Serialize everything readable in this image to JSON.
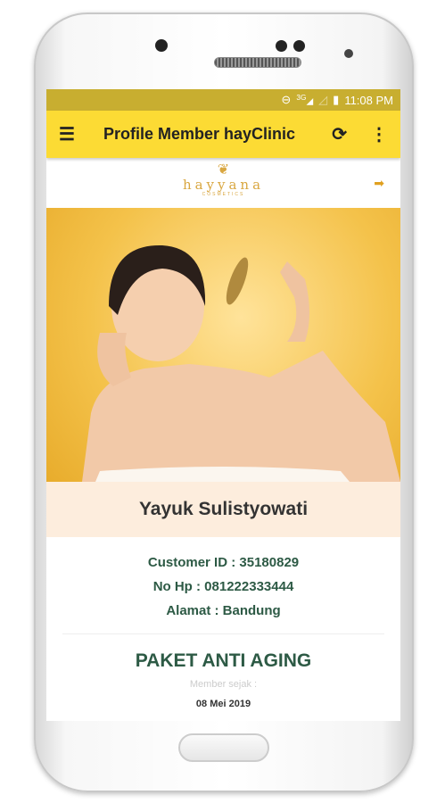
{
  "status_bar": {
    "time": "11:08 PM",
    "network": "3G"
  },
  "toolbar": {
    "title": "Profile Member hayClinic",
    "menu_icon": "hamburger-icon",
    "refresh_icon": "refresh-icon",
    "more_icon": "more-vert-icon"
  },
  "brand": {
    "name": "hayyana",
    "sub": "COSMETICS"
  },
  "profile": {
    "name": "Yayuk Sulistyowati",
    "customer_id": "Customer ID : 35180829",
    "phone": "No Hp : 081222333444",
    "address": "Alamat : Bandung"
  },
  "package": {
    "title": "PAKET ANTI AGING",
    "member_since_label": "Member sejak :",
    "member_since_date": "08 Mei 2019"
  },
  "colors": {
    "toolbar": "#fcdb34",
    "status": "#c8ae30",
    "accent_text": "#2d5a45"
  }
}
